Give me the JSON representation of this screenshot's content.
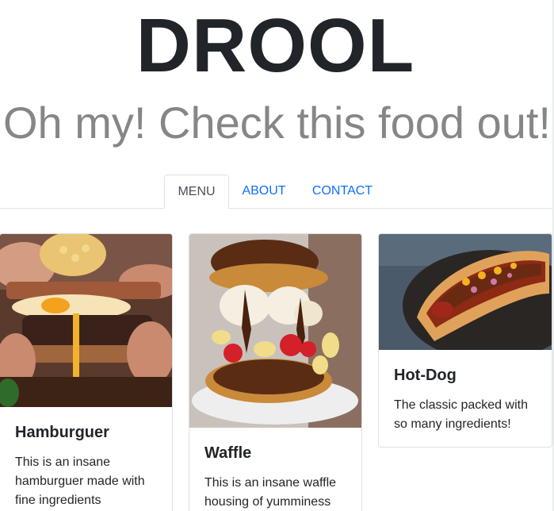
{
  "header": {
    "brand": "DROOL",
    "tagline": "Oh my! Check this food out!"
  },
  "nav": {
    "tabs": [
      {
        "label": "MENU",
        "active": true
      },
      {
        "label": "ABOUT",
        "active": false
      },
      {
        "label": "CONTACT",
        "active": false
      }
    ]
  },
  "cards": [
    {
      "image_icon": "hamburger-photo",
      "title": "Hamburguer",
      "text": "This is an insane hamburguer made with fine ingredients"
    },
    {
      "image_icon": "waffle-photo",
      "title": "Waffle",
      "text": "This is an insane waffle housing of yumminess"
    },
    {
      "image_icon": "hotdog-photo",
      "title": "Hot-Dog",
      "text": "The classic packed with so many ingredients!"
    }
  ],
  "colors": {
    "brand_text": "#212529",
    "tagline_text": "#868686",
    "link": "#0d6efd",
    "active_tab_text": "#495057",
    "border": "#dee2e6"
  }
}
